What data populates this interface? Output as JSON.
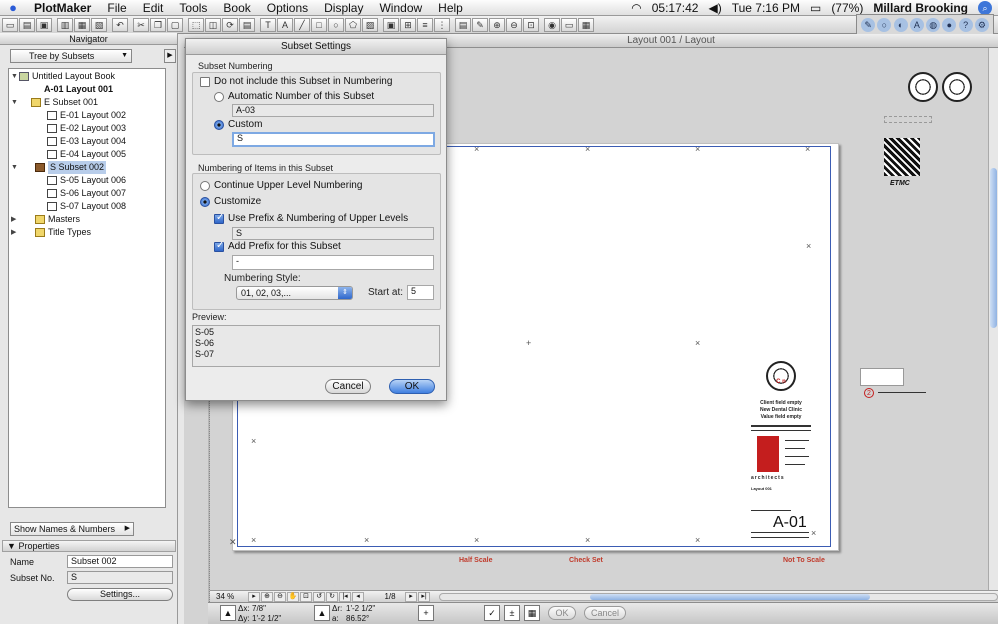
{
  "menubar": {
    "app_name": "PlotMaker",
    "items": [
      "File",
      "Edit",
      "Tools",
      "Book",
      "Options",
      "Display",
      "Window",
      "Help"
    ],
    "clock_a": "05:17:42",
    "clock_b": "Tue 7:16 PM",
    "battery": "(77%)",
    "user": "Millard Brooking"
  },
  "navigator": {
    "title": "Navigator",
    "view_mode": "Tree by Subsets",
    "tree": [
      {
        "label": "Untitled Layout Book",
        "depth": 0,
        "icon": "book",
        "tri": "▼"
      },
      {
        "label": "A-01 Layout 001",
        "depth": 1,
        "icon": "",
        "tri": "",
        "bold": true
      },
      {
        "label": "E Subset 001",
        "depth": 1,
        "icon": "folder",
        "tri": "▼"
      },
      {
        "label": "E-01 Layout 002",
        "depth": 2,
        "icon": "page",
        "tri": ""
      },
      {
        "label": "E-02 Layout 003",
        "depth": 2,
        "icon": "page",
        "tri": ""
      },
      {
        "label": "E-03 Layout 004",
        "depth": 2,
        "icon": "page",
        "tri": ""
      },
      {
        "label": "E-04 Layout 005",
        "depth": 2,
        "icon": "page",
        "tri": ""
      },
      {
        "label": "S Subset 002",
        "depth": 1,
        "icon": "brown",
        "tri": "▼",
        "selected": true
      },
      {
        "label": "S-05 Layout 006",
        "depth": 2,
        "icon": "page",
        "tri": ""
      },
      {
        "label": "S-06 Layout 007",
        "depth": 2,
        "icon": "page",
        "tri": ""
      },
      {
        "label": "S-07 Layout 008",
        "depth": 2,
        "icon": "page",
        "tri": ""
      },
      {
        "label": "Masters",
        "depth": 1,
        "icon": "folder",
        "tri": "▶"
      },
      {
        "label": "Title Types",
        "depth": 1,
        "icon": "folder",
        "tri": "▶"
      }
    ],
    "show_mode": "Show Names & Numbers",
    "properties": {
      "title": "Properties",
      "name_label": "Name",
      "name_value": "Subset 002",
      "subset_no_label": "Subset No.",
      "subset_no_value": "S",
      "settings_button": "Settings..."
    }
  },
  "layout_window": {
    "title": "Layout 001 / Layout",
    "zoom": "34 %",
    "page_indicator": "1/8",
    "labels": {
      "half_scale": "Half Scale",
      "check_set": "Check Set",
      "not_to_scale": "Not To Scale"
    },
    "title_block": {
      "logo_text": "ETMC",
      "sheet_number": "A-01",
      "client_lines": [
        "Client field empty",
        "New  Dental  Clinic",
        "Value field empty"
      ],
      "firm": "architects",
      "layout_name": "Layout 001",
      "seal_text": "C     n",
      "callout_number": "2"
    }
  },
  "coordbar": {
    "dx_label": "Δx:",
    "dx_value": "7/8\"",
    "dy_label": "Δy:",
    "dy_value": "1'-2 1/2\"",
    "dr_label": "Δr:",
    "dr_value": "1'-2 1/2\"",
    "a_label": "a:",
    "a_value": "86.52°",
    "ok": "OK",
    "cancel": "Cancel"
  },
  "dialog": {
    "title": "Subset Settings",
    "subset_numbering": {
      "section_label": "Subset Numbering",
      "do_not_include_label": "Do not include this Subset in Numbering",
      "do_not_include_checked": false,
      "automatic_label": "Automatic Number of this Subset",
      "automatic_value": "A-03",
      "custom_label": "Custom",
      "custom_value": "S",
      "selected": "custom"
    },
    "items_numbering": {
      "section_label": "Numbering of Items in this Subset",
      "continue_label": "Continue Upper Level Numbering",
      "customize_label": "Customize",
      "selected": "customize",
      "use_prefix_label": "Use Prefix & Numbering of Upper Levels",
      "use_prefix_checked": true,
      "use_prefix_value": "S",
      "add_prefix_label": "Add Prefix for this Subset",
      "add_prefix_checked": true,
      "add_prefix_value": "-",
      "style_label": "Numbering Style:",
      "style_value": "01, 02, 03,...",
      "start_label": "Start at:",
      "start_value": "5"
    },
    "preview": {
      "label": "Preview:",
      "lines": [
        "S-05",
        "S-06",
        "S-07",
        "..."
      ]
    },
    "cancel_button": "Cancel",
    "ok_button": "OK"
  }
}
